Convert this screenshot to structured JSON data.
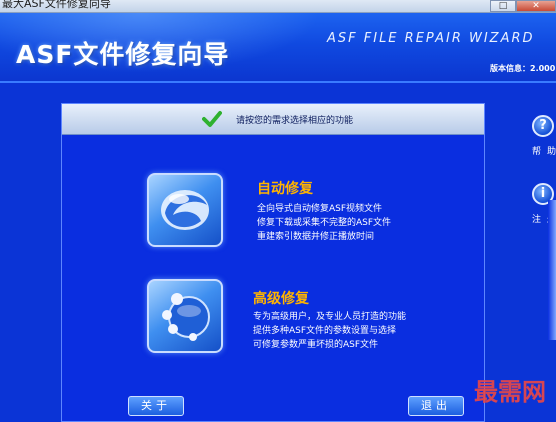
{
  "window": {
    "title": "最大ASF文件修复向导",
    "maximize_glyph": "□",
    "close_glyph": "✕"
  },
  "header": {
    "app_title": "ASF文件修复向导",
    "english_title": "ASF FILE REPAIR WIZARD",
    "version_label": "版本信息：2.000"
  },
  "panel": {
    "prompt": "请按您的需求选择相应的功能",
    "options": [
      {
        "title": "自动修复",
        "icon": "auto-repair-icon",
        "lines": [
          "全向导式自动修复ASF视频文件",
          "修复下载或采集不完整的ASF文件",
          "重建索引数据并修正播放时间"
        ]
      },
      {
        "title": "高级修复",
        "icon": "advanced-repair-icon",
        "lines": [
          "专为高级用户，及专业人员打造的功能",
          "提供多种ASF文件的参数设置与选择",
          "可修复参数严重坏损的ASF文件"
        ]
      }
    ]
  },
  "buttons": {
    "about": "关于",
    "exit": "退出"
  },
  "sidebar": {
    "help": {
      "glyph": "?",
      "label": "帮助"
    },
    "note": {
      "glyph": "i",
      "label": "注册"
    }
  },
  "watermark": "最需网",
  "colors": {
    "background": "#0b34d6",
    "accent_title": "#ffb400",
    "panel": "#0a2ee0"
  }
}
